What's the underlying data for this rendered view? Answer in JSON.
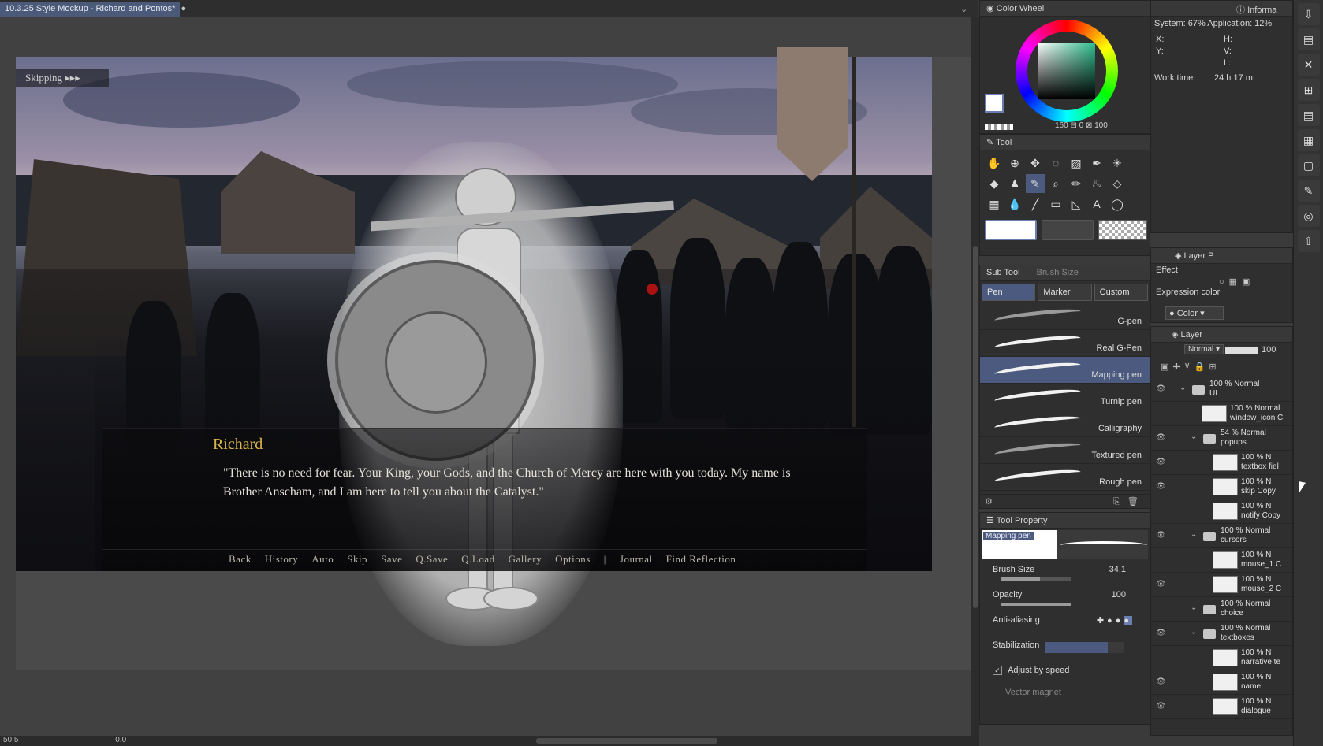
{
  "document": {
    "tab_title": "10.3.25 Style Mockup - Richard and Pontos*",
    "status_zoom": "50.5",
    "status_angle": "0.0"
  },
  "scene": {
    "skip_indicator": "Skipping ▸▸▸",
    "speaker": "Richard",
    "dialogue": "\"There is no need for fear. Your King, your Gods, and the Church of Mercy are here with you today. My name is Brother Anscham, and I am here to tell you about the Catalyst.\"",
    "quick_menu": [
      "Back",
      "History",
      "Auto",
      "Skip",
      "Save",
      "Q.Save",
      "Q.Load",
      "Gallery",
      "Options",
      "|",
      "Journal",
      "Find Reflection"
    ]
  },
  "color_wheel": {
    "title": "Color Wheel",
    "value_h": "160",
    "value_s": "0",
    "value_v": "100"
  },
  "tool": {
    "title": "Tool",
    "icons": [
      "hand-icon",
      "zoom-tool-icon",
      "move-icon",
      "lasso-icon",
      "gradient-icon",
      "eyedropper-icon",
      "sparkle-icon",
      "fill-icon",
      "figure-icon",
      "pen-icon",
      "magnifier-icon",
      "pencil-icon",
      "airbrush-icon",
      "eraser-icon",
      "frame-icon",
      "blend-icon",
      "line-icon",
      "ruler-icon",
      "pointer-icon",
      "text-icon",
      "balloon-icon",
      "correct-line-icon"
    ]
  },
  "sub_tool": {
    "title": "Sub Tool",
    "title2": "Brush Size",
    "tabs": [
      "Pen",
      "Marker",
      "Custom"
    ],
    "brushes": [
      "G-pen",
      "Real G-Pen",
      "Mapping pen",
      "Turnip pen",
      "Calligraphy",
      "Textured pen",
      "Rough pen"
    ],
    "selected": "Mapping pen"
  },
  "tool_property": {
    "title": "Tool Property",
    "preview_label": "Mapping pen",
    "brush_size_label": "Brush Size",
    "brush_size_value": "34.1",
    "opacity_label": "Opacity",
    "opacity_value": "100",
    "antialiasing_label": "Anti-aliasing",
    "stabilization_label": "Stabilization",
    "adjust_speed_label": "Adjust by speed",
    "vector_magnet_label": "Vector magnet"
  },
  "info": {
    "title": "Informa",
    "system": "System: 67%  Application: 12%",
    "x_label": "X:",
    "y_label": "Y:",
    "h_label": "H:",
    "v_label": "V:",
    "l_label": "L:",
    "work_time_label": "Work time:",
    "work_time_value": "24 h 17 m"
  },
  "layer_property": {
    "title": "Layer P",
    "effect_label": "Effect",
    "expression_label": "Expression color",
    "expression_value": "Color"
  },
  "layers": {
    "title": "Layer",
    "blend_mode": "Normal",
    "opacity": "100",
    "items": [
      {
        "pct": "100 % Normal",
        "name": "UI",
        "kind": "folder",
        "indent": 0,
        "visible": true
      },
      {
        "pct": "100 % Normal",
        "name": "window_icon C",
        "kind": "layer",
        "indent": 1,
        "visible": false
      },
      {
        "pct": "54 % Normal",
        "name": "popups",
        "kind": "folder",
        "indent": 1,
        "visible": true
      },
      {
        "pct": "100 % N",
        "name": "textbox fiel",
        "kind": "layer",
        "indent": 2,
        "visible": true
      },
      {
        "pct": "100 % N",
        "name": "skip Copy",
        "kind": "layer",
        "indent": 2,
        "visible": true
      },
      {
        "pct": "100 % N",
        "name": "notify Copy",
        "kind": "layer",
        "indent": 2,
        "visible": false
      },
      {
        "pct": "100 % Normal",
        "name": "cursors",
        "kind": "folder",
        "indent": 1,
        "visible": true
      },
      {
        "pct": "100 % N",
        "name": "mouse_1 C",
        "kind": "layer",
        "indent": 2,
        "visible": false
      },
      {
        "pct": "100 % N",
        "name": "mouse_2 C",
        "kind": "layer",
        "indent": 2,
        "visible": true
      },
      {
        "pct": "100 % Normal",
        "name": "choice",
        "kind": "folder",
        "indent": 1,
        "visible": false
      },
      {
        "pct": "100 % Normal",
        "name": "textboxes",
        "kind": "folder",
        "indent": 1,
        "visible": true
      },
      {
        "pct": "100 % N",
        "name": "narrative te",
        "kind": "layer",
        "indent": 2,
        "visible": false
      },
      {
        "pct": "100 % N",
        "name": "name",
        "kind": "layer",
        "indent": 2,
        "visible": true
      },
      {
        "pct": "100 % N",
        "name": "dialogue",
        "kind": "layer",
        "indent": 2,
        "visible": true
      }
    ]
  },
  "colors": {
    "accent": "#4b5a7e",
    "speaker": "#d9b64a"
  }
}
